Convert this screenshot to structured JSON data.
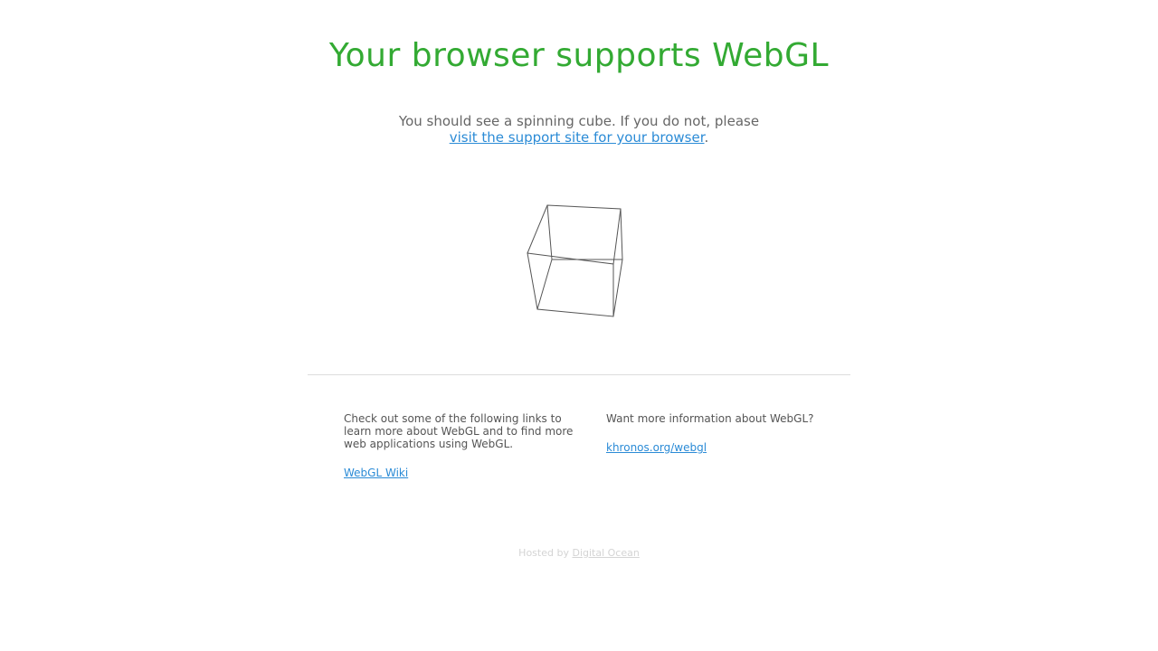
{
  "header": {
    "title": "Your browser supports WebGL"
  },
  "intro": {
    "text": "You should see a spinning cube. If you do not, please",
    "link_text": "visit the support site for your browser",
    "trailing": "."
  },
  "cube": {
    "description_icon": "wireframe-cube-icon",
    "stroke_color": "#555555"
  },
  "left_column": {
    "text": "Check out some of the following links to learn more about WebGL and to find more web applications using WebGL.",
    "link_text": "WebGL Wiki"
  },
  "right_column": {
    "text": "Want more information about WebGL?",
    "link_text": "khronos.org/webgl"
  },
  "footer": {
    "prefix": "Hosted by",
    "link_text": "Digital Ocean"
  },
  "colors": {
    "title": "#33aa33",
    "link": "#2b8bd6",
    "body_text": "#666666",
    "footer_text": "#d4d4d4"
  }
}
